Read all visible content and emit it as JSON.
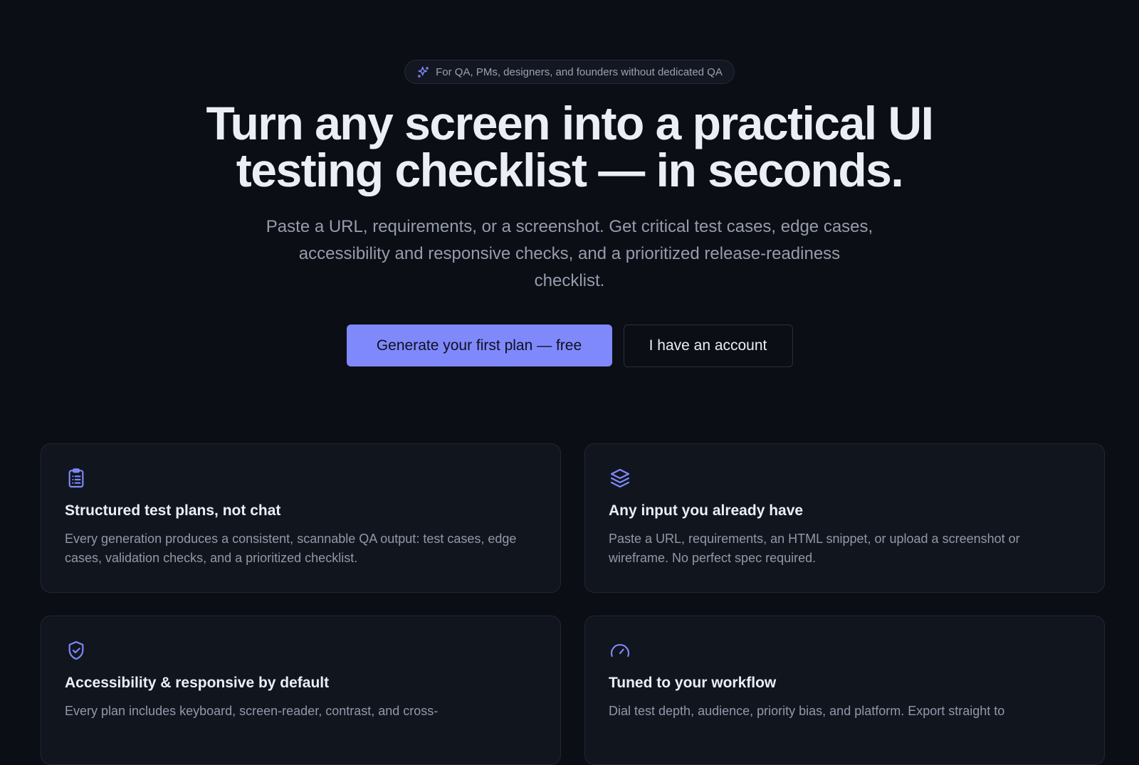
{
  "hero": {
    "pill_text": "For QA, PMs, designers, and founders without dedicated QA",
    "pill_icon": "sparkles-icon",
    "headline": "Turn any screen into a practical UI testing checklist — in seconds.",
    "subtitle": "Paste a URL, requirements, or a screenshot. Get critical test cases, edge cases, accessibility and responsive checks, and a prioritized release-readiness checklist.",
    "primary_cta": "Generate your first plan — free",
    "secondary_cta": "I have an account"
  },
  "features": [
    {
      "icon": "clipboard-list-icon",
      "title": "Structured test plans, not chat",
      "description": "Every generation produces a consistent, scannable QA output: test cases, edge cases, validation checks, and a prioritized checklist."
    },
    {
      "icon": "layers-icon",
      "title": "Any input you already have",
      "description": "Paste a URL, requirements, an HTML snippet, or upload a screenshot or wireframe. No perfect spec required."
    },
    {
      "icon": "shield-check-icon",
      "title": "Accessibility & responsive by default",
      "description": "Every plan includes keyboard, screen-reader, contrast, and cross-"
    },
    {
      "icon": "gauge-icon",
      "title": "Tuned to your workflow",
      "description": "Dial test depth, audience, priority bias, and platform. Export straight to"
    }
  ],
  "colors": {
    "background": "#0b0e15",
    "accent": "#8089fb",
    "card": "#11151e",
    "text_primary": "#eceef5",
    "text_muted": "#969cac"
  }
}
